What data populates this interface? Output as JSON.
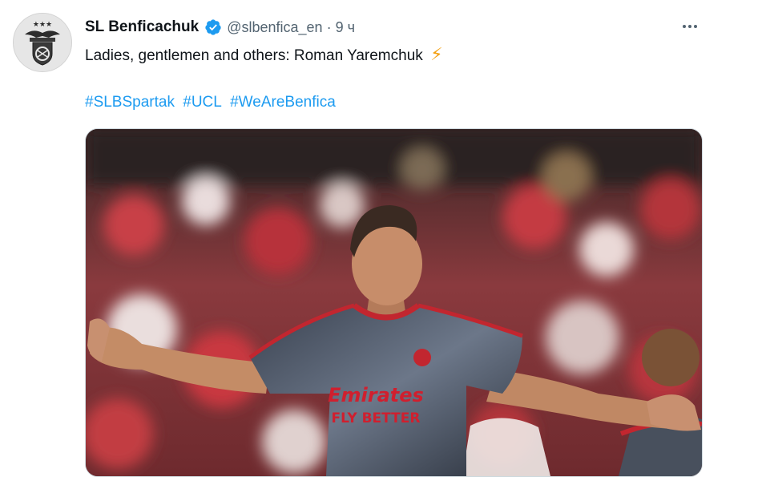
{
  "tweet": {
    "author_name": "SL Benficachuk",
    "handle": "@slbenfica_en",
    "separator": "·",
    "time": "9 ч",
    "text": "Ladies, gentlemen and others: Roman Yaremchuk",
    "emoji": "⚡",
    "hashtags": [
      "#SLBSpartak",
      "#UCL",
      "#WeAreBenfica"
    ],
    "media": {
      "alt_icon": "photo",
      "shirt_sponsor_line1": "Emirates",
      "shirt_sponsor_line2": "FLY BETTER"
    }
  },
  "icons": {
    "avatar": "benfica-crest-icon",
    "verified": "verified-badge-icon",
    "more": "more-options-icon"
  },
  "colors": {
    "link": "#1d9bf0",
    "verified": "#1d9bf0",
    "secondary_text": "#536471",
    "kit_red": "#d01f2e"
  }
}
